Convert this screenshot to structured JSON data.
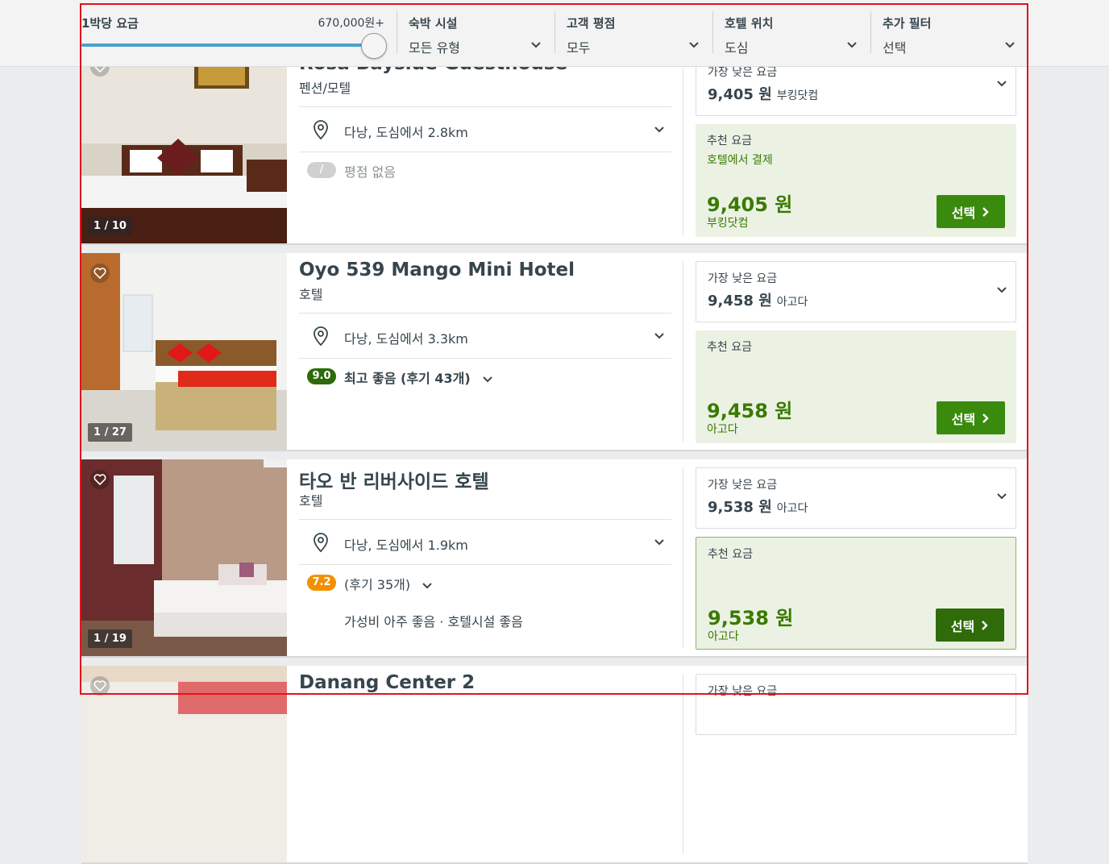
{
  "filters": {
    "price": {
      "label": "1박당 요금",
      "max": "670,000원+",
      "level": 1.0
    },
    "groups": [
      {
        "title": "숙박 시설",
        "value": "모든 유형"
      },
      {
        "title": "고객 평점",
        "value": "모두"
      },
      {
        "title": "호텔 위치",
        "value": "도심"
      },
      {
        "title": "추가 필터",
        "value": "선택"
      }
    ]
  },
  "hotels": [
    {
      "name": "Rosa Bayside Guesthouse",
      "type": "펜션/모텔",
      "location": "다낭, 도심에서 2.8km",
      "photo_counter": "1 / 10",
      "rating_score": "/",
      "rating_text": "평점 없음",
      "rating_color": "#d0d0d0",
      "lowest_label": "가장 낮은 요금",
      "lowest_price": "9,405 원",
      "lowest_provider": "부킹닷컴",
      "rec_label": "추천 요금",
      "rec_note": "호텔에서 결제",
      "rec_price": "9,405 원",
      "rec_provider": "부킹닷컴",
      "select": "선택"
    },
    {
      "name": "Oyo 539 Mango Mini Hotel",
      "type": "호텔",
      "location": "다낭, 도심에서 3.3km",
      "photo_counter": "1 / 27",
      "rating_score": "9.0",
      "rating_text": "최고 좋음 (후기 43개)",
      "rating_color": "#2c6b09",
      "lowest_label": "가장 낮은 요금",
      "lowest_price": "9,458 원",
      "lowest_provider": "아고다",
      "rec_label": "추천 요금",
      "rec_note": "",
      "rec_price": "9,458 원",
      "rec_provider": "아고다",
      "select": "선택"
    },
    {
      "name": "타오 반 리버사이드 호텔",
      "type": "호텔",
      "location": "다낭, 도심에서 1.9km",
      "photo_counter": "1 / 19",
      "rating_score": "7.2",
      "rating_text": "(후기 35개)",
      "rating_color": "#f29100",
      "rating_sub": "가성비 아주 좋음 · 호텔시설 좋음",
      "lowest_label": "가장 낮은 요금",
      "lowest_price": "9,538 원",
      "lowest_provider": "아고다",
      "rec_label": "추천 요금",
      "rec_note": "",
      "rec_price": "9,538 원",
      "rec_provider": "아고다",
      "select": "선택"
    },
    {
      "name": "Danang Center 2",
      "type": "",
      "location": "",
      "photo_counter": "",
      "lowest_label": "가장 낮은 요금"
    }
  ],
  "colors": {
    "accent_green": "#3a7a00",
    "button_green": "#3a8a0e",
    "slider_blue": "#4f9fcf",
    "highlight_red": "#e0141e"
  }
}
